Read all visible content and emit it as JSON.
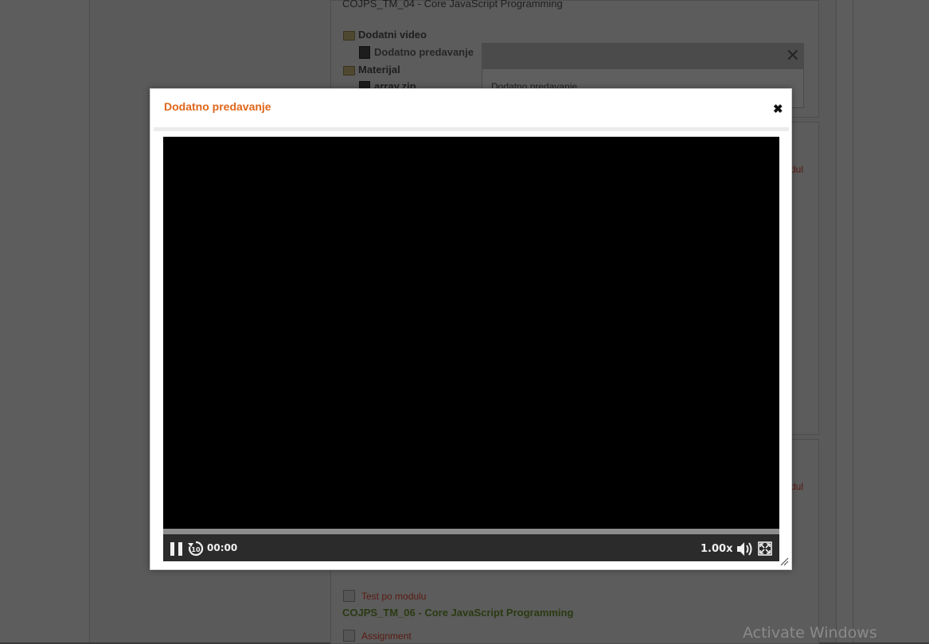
{
  "background": {
    "course_top": "COJPS_TM_04 - Core JavaScript Programming",
    "folder_video": "Dodatni video",
    "item_video": "Dodatno predavanje",
    "folder_material": "Materijal",
    "item_material": "array.zip",
    "popup_text": "Dodatno predavanje",
    "right_fragment_1": "dul",
    "right_fragment_2": "dul",
    "test_label": "Test po modulu",
    "course_06": "COJPS_TM_06 - Core JavaScript Programming",
    "assignment_label": "Assignment"
  },
  "modal": {
    "title": "Dodatno predavanje",
    "close_glyph": "✖"
  },
  "player": {
    "time": "00:00",
    "speed": "1.00x",
    "progress": 0
  },
  "watermark": "Activate Windows"
}
